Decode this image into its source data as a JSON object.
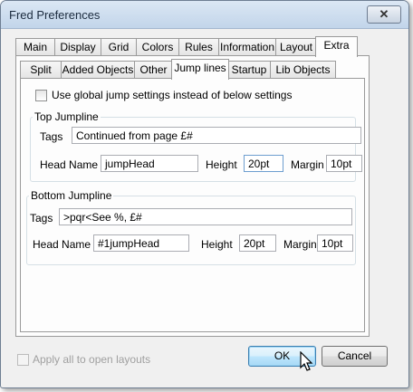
{
  "window": {
    "title": "Fred Preferences",
    "close_symbol": "✕"
  },
  "tabs_top": [
    {
      "label": "Main"
    },
    {
      "label": "Display"
    },
    {
      "label": "Grid"
    },
    {
      "label": "Colors"
    },
    {
      "label": "Rules"
    },
    {
      "label": "Information"
    },
    {
      "label": "Layout"
    },
    {
      "label": "Extra"
    }
  ],
  "tabs_sub": [
    {
      "label": "Split"
    },
    {
      "label": "Added Objects"
    },
    {
      "label": "Other"
    },
    {
      "label": "Jump lines"
    },
    {
      "label": "Startup"
    },
    {
      "label": "Lib Objects"
    }
  ],
  "selected_top_tab": "Extra",
  "selected_sub_tab": "Jump lines",
  "global_option": {
    "label": "Use global jump settings instead of below settings",
    "checked": false
  },
  "top_group": {
    "title": "Top Jumpline",
    "tags_label": "Tags",
    "tags_value": "Continued from page £#",
    "head_label": "Head Name",
    "head_value": "jumpHead",
    "height_label": "Height",
    "height_value": "20pt",
    "margin_label": "Margin",
    "margin_value": "10pt"
  },
  "bottom_group": {
    "title": "Bottom Jumpline",
    "tags_label": "Tags",
    "tags_value": ">pqr<See %, £#",
    "head_label": "Head Name",
    "head_value": "#1jumpHead",
    "height_label": "Height",
    "height_value": "20pt",
    "margin_label": "Margin",
    "margin_value": "10pt"
  },
  "apply_all": {
    "label": "Apply all to open layouts",
    "checked": false,
    "enabled": false
  },
  "buttons": {
    "ok": "OK",
    "cancel": "Cancel"
  }
}
